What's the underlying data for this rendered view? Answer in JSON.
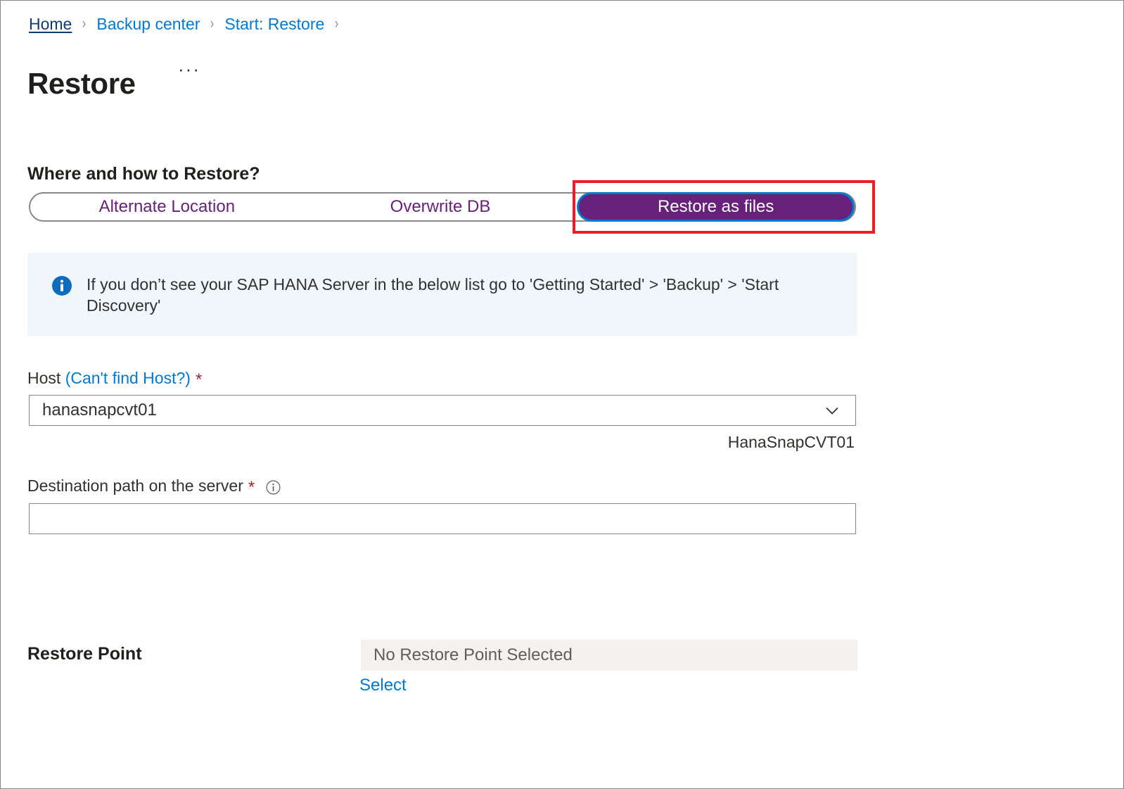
{
  "breadcrumb": {
    "items": [
      {
        "label": "Home",
        "current": false
      },
      {
        "label": "Backup center",
        "current": false
      },
      {
        "label": "Start: Restore",
        "current": false
      }
    ],
    "separator": "›"
  },
  "header": {
    "title": "Restore",
    "more_menu": "···"
  },
  "main": {
    "section_heading": "Where and how to Restore?",
    "tabs": [
      {
        "label": "Alternate Location",
        "selected": false
      },
      {
        "label": "Overwrite DB",
        "selected": false
      },
      {
        "label": "Restore as files",
        "selected": true
      }
    ],
    "info_banner": {
      "icon": "info-circle-filled-icon",
      "text": "If you don’t see your SAP HANA Server in the below list go to 'Getting Started' > 'Backup' > 'Start Discovery'"
    },
    "host_field": {
      "label": "Host",
      "link_label": "(Can't find Host?)",
      "required_marker": "*",
      "value": "hanasnapcvt01",
      "chevron_icon": "chevron-down-icon",
      "helper_text": "HanaSnapCVT01"
    },
    "destination_field": {
      "label": "Destination path on the server",
      "required_marker": "*",
      "info_icon": "info-circle-outline-icon",
      "value": "",
      "placeholder": ""
    },
    "restore_point": {
      "label": "Restore Point",
      "value": "No Restore Point Selected",
      "select_label": "Select"
    }
  },
  "annotation": {
    "shape": "rectangle",
    "color": "#EC1C24",
    "target": "Restore as files"
  },
  "colors": {
    "accent_purple": "#68217A",
    "focus_blue": "#0078D4",
    "link_blue": "#0078D4",
    "required_red": "#A4262C",
    "annotation_red": "#EC1C24",
    "banner_bg": "#EFF6FC",
    "disabled_bg": "#F3F2F1"
  }
}
